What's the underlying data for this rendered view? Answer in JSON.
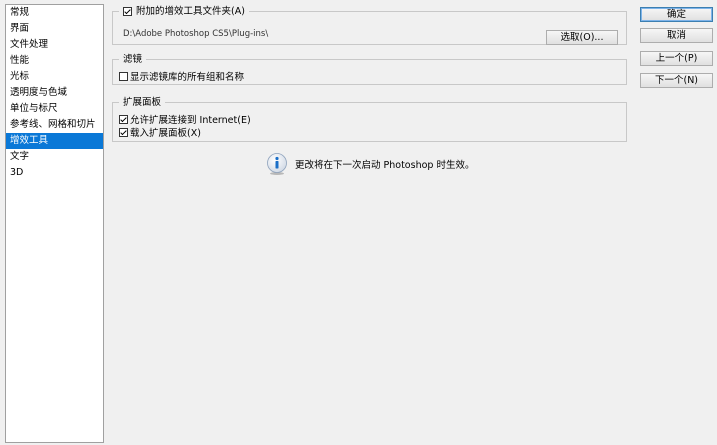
{
  "sidebar": {
    "items": [
      {
        "label": "常规",
        "selected": false
      },
      {
        "label": "界面",
        "selected": false
      },
      {
        "label": "文件处理",
        "selected": false
      },
      {
        "label": "性能",
        "selected": false
      },
      {
        "label": "光标",
        "selected": false
      },
      {
        "label": "透明度与色域",
        "selected": false
      },
      {
        "label": "单位与标尺",
        "selected": false
      },
      {
        "label": "参考线、网格和切片",
        "selected": false
      },
      {
        "label": "增效工具",
        "selected": true
      },
      {
        "label": "文字",
        "selected": false
      },
      {
        "label": "3D",
        "selected": false
      }
    ]
  },
  "plugins_folder": {
    "label": "附加的增效工具文件夹(A)",
    "checked": true,
    "path": "D:\\Adobe Photoshop CS5\\Plug-ins\\",
    "choose_label": "选取(O)..."
  },
  "filters": {
    "title": "滤镜",
    "show_all_label": "显示滤镜库的所有组和名称",
    "show_all_checked": false
  },
  "extension_panels": {
    "title": "扩展面板",
    "allow_internet_label": "允许扩展连接到 Internet(E)",
    "allow_internet_checked": true,
    "load_panels_label": "载入扩展面板(X)",
    "load_panels_checked": true
  },
  "info": {
    "icon": "info-icon",
    "message": "更改将在下一次启动 Photoshop 时生效。"
  },
  "buttons": {
    "ok": "确定",
    "cancel": "取消",
    "prev": "上一个(P)",
    "next": "下一个(N)"
  },
  "colors": {
    "selection": "#0a78d7",
    "info_blue": "#1a6fc8"
  }
}
